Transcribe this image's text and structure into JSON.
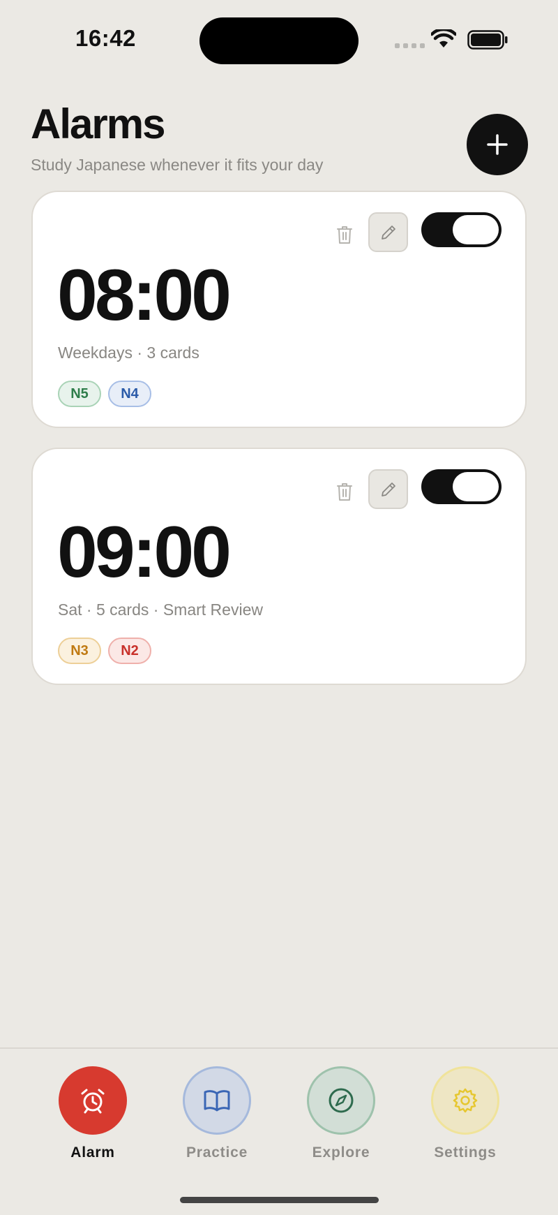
{
  "status": {
    "time": "16:42"
  },
  "header": {
    "title": "Alarms",
    "subtitle": "Study Japanese whenever it fits your day"
  },
  "alarms": [
    {
      "time": "08:00",
      "meta": "Weekdays · 3 cards",
      "enabled": true,
      "tags": [
        {
          "label": "N5",
          "color": "#2E7D4A",
          "bg": "#E8F3EC",
          "border": "#A9D3B6"
        },
        {
          "label": "N4",
          "color": "#2A5AA8",
          "bg": "#E8EEF8",
          "border": "#A7BEE6"
        }
      ]
    },
    {
      "time": "09:00",
      "meta": "Sat · 5 cards · Smart Review",
      "enabled": true,
      "tags": [
        {
          "label": "N3",
          "color": "#C07A12",
          "bg": "#FBF1DF",
          "border": "#EDCF97"
        },
        {
          "label": "N2",
          "color": "#C8302A",
          "bg": "#FBE8E6",
          "border": "#EFB0AB"
        }
      ]
    }
  ],
  "tabs": [
    {
      "label": "Alarm",
      "icon": "alarm-clock-icon",
      "active": true,
      "color": "#D73A2F"
    },
    {
      "label": "Practice",
      "icon": "book-icon",
      "active": false,
      "color": "#3A66B5"
    },
    {
      "label": "Explore",
      "icon": "compass-icon",
      "active": false,
      "color": "#2E6B4E"
    },
    {
      "label": "Settings",
      "icon": "gear-icon",
      "active": false,
      "color": "#E6C72F"
    }
  ]
}
